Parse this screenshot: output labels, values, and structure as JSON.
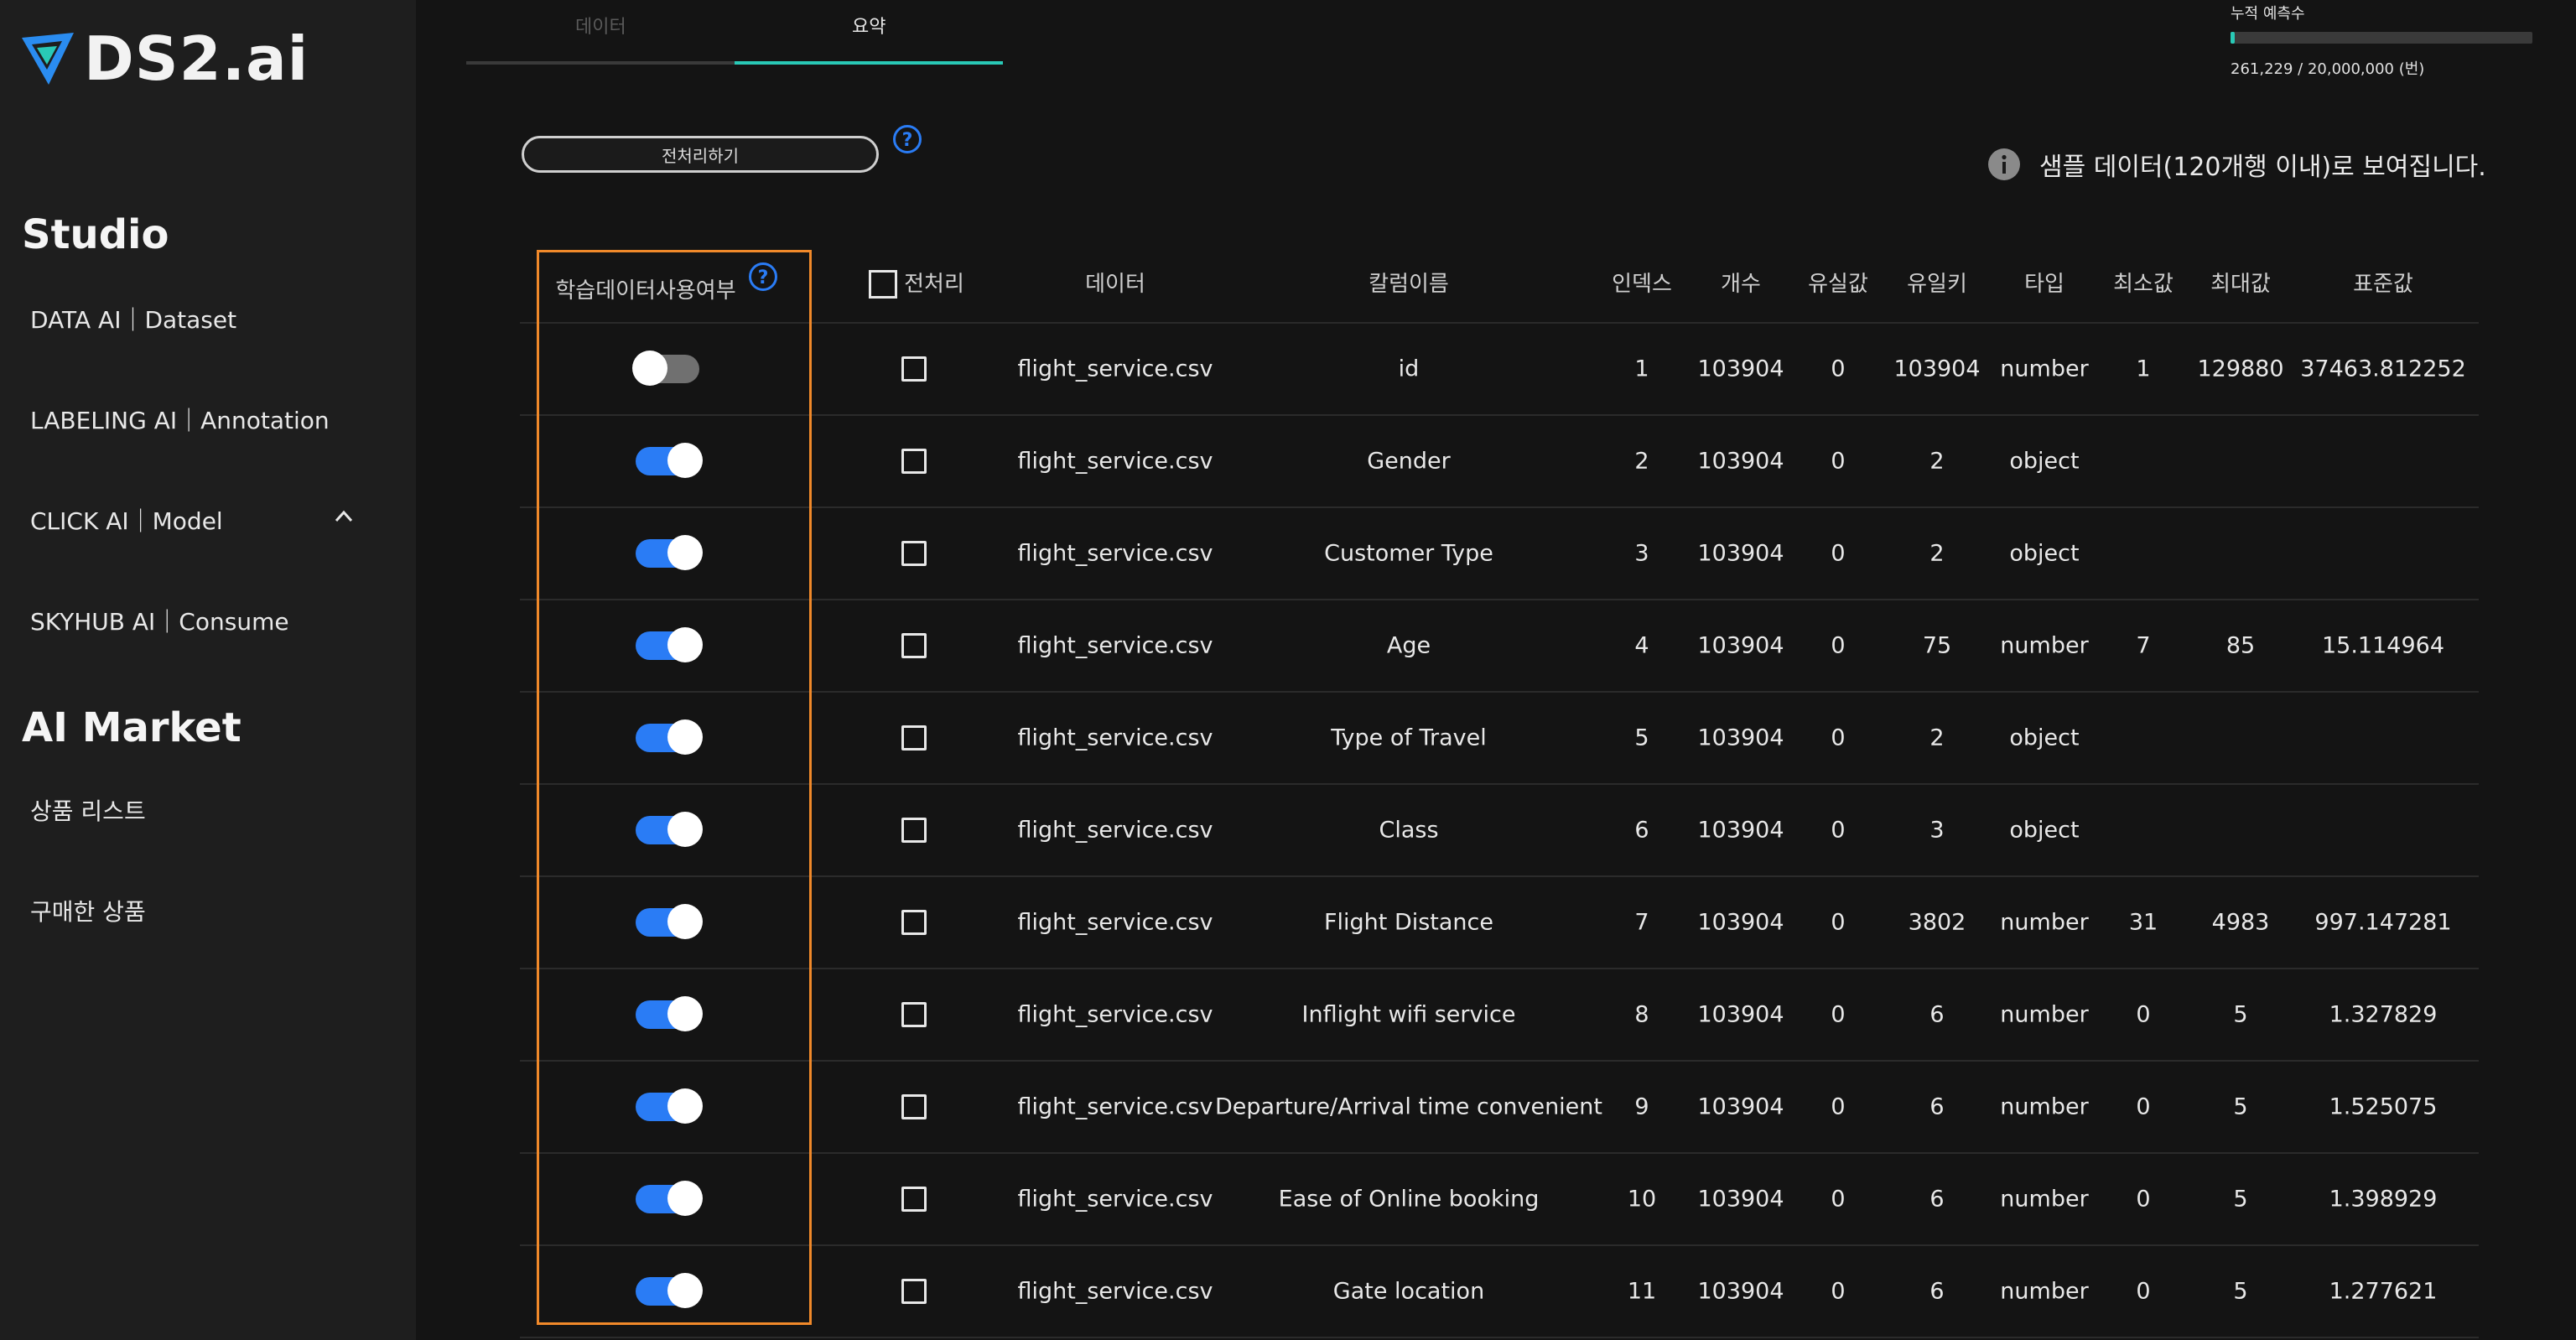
{
  "app": {
    "logo_text": "DS2.ai",
    "colors": {
      "accent": "#2a7cf5",
      "teal": "#29c9b6",
      "highlight": "#f0892a"
    }
  },
  "sidebar": {
    "studio_title": "Studio",
    "studio_items": [
      "DATA AI｜Dataset",
      "LABELING AI｜Annotation",
      "CLICK AI｜Model",
      "SKYHUB AI｜Consume"
    ],
    "market_title": "AI Market",
    "market_items": [
      "상품 리스트",
      "구매한 상품"
    ]
  },
  "tabs": [
    {
      "label": "데이터",
      "active": false
    },
    {
      "label": "요약",
      "active": true
    }
  ],
  "quota": {
    "label": "누적 예측수",
    "text": "261,229 / 20,000,000 (번)",
    "progress": 0.013
  },
  "toolbar": {
    "preprocess_label": "전처리하기"
  },
  "notice": {
    "text": "샘플 데이터(120개행 이내)로 보여집니다."
  },
  "table": {
    "headers": {
      "use": "학습데이터사용여부",
      "preprocess": "전처리",
      "data": "데이터",
      "column_name": "칼럼이름",
      "index": "인덱스",
      "count": "개수",
      "missing": "유실값",
      "unique": "유일키",
      "type": "타입",
      "min": "최소값",
      "max": "최대값",
      "std": "표준값"
    },
    "rows": [
      {
        "use": false,
        "data": "flight_service.csv",
        "column": "id",
        "index": "1",
        "count": "103904",
        "missing": "0",
        "unique": "103904",
        "type": "number",
        "min": "1",
        "max": "129880",
        "std": "37463.812252"
      },
      {
        "use": true,
        "data": "flight_service.csv",
        "column": "Gender",
        "index": "2",
        "count": "103904",
        "missing": "0",
        "unique": "2",
        "type": "object",
        "min": "",
        "max": "",
        "std": ""
      },
      {
        "use": true,
        "data": "flight_service.csv",
        "column": "Customer Type",
        "index": "3",
        "count": "103904",
        "missing": "0",
        "unique": "2",
        "type": "object",
        "min": "",
        "max": "",
        "std": ""
      },
      {
        "use": true,
        "data": "flight_service.csv",
        "column": "Age",
        "index": "4",
        "count": "103904",
        "missing": "0",
        "unique": "75",
        "type": "number",
        "min": "7",
        "max": "85",
        "std": "15.114964"
      },
      {
        "use": true,
        "data": "flight_service.csv",
        "column": "Type of Travel",
        "index": "5",
        "count": "103904",
        "missing": "0",
        "unique": "2",
        "type": "object",
        "min": "",
        "max": "",
        "std": ""
      },
      {
        "use": true,
        "data": "flight_service.csv",
        "column": "Class",
        "index": "6",
        "count": "103904",
        "missing": "0",
        "unique": "3",
        "type": "object",
        "min": "",
        "max": "",
        "std": ""
      },
      {
        "use": true,
        "data": "flight_service.csv",
        "column": "Flight Distance",
        "index": "7",
        "count": "103904",
        "missing": "0",
        "unique": "3802",
        "type": "number",
        "min": "31",
        "max": "4983",
        "std": "997.147281"
      },
      {
        "use": true,
        "data": "flight_service.csv",
        "column": "Inflight wifi service",
        "index": "8",
        "count": "103904",
        "missing": "0",
        "unique": "6",
        "type": "number",
        "min": "0",
        "max": "5",
        "std": "1.327829"
      },
      {
        "use": true,
        "data": "flight_service.csv",
        "column": "Departure/Arrival time convenient",
        "index": "9",
        "count": "103904",
        "missing": "0",
        "unique": "6",
        "type": "number",
        "min": "0",
        "max": "5",
        "std": "1.525075"
      },
      {
        "use": true,
        "data": "flight_service.csv",
        "column": "Ease of Online booking",
        "index": "10",
        "count": "103904",
        "missing": "0",
        "unique": "6",
        "type": "number",
        "min": "0",
        "max": "5",
        "std": "1.398929"
      },
      {
        "use": true,
        "data": "flight_service.csv",
        "column": "Gate location",
        "index": "11",
        "count": "103904",
        "missing": "0",
        "unique": "6",
        "type": "number",
        "min": "0",
        "max": "5",
        "std": "1.277621"
      }
    ]
  }
}
